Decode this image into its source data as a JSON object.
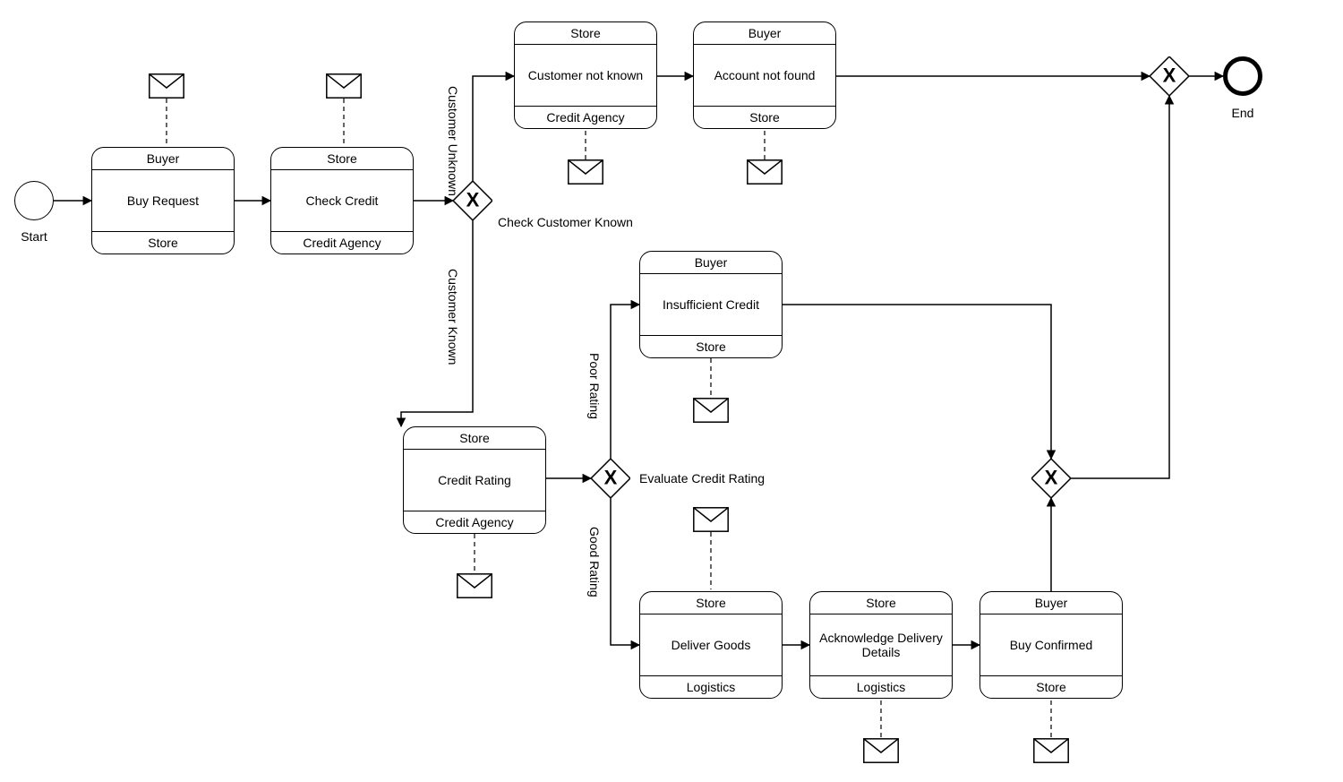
{
  "events": {
    "start": "Start",
    "end": "End"
  },
  "activities": {
    "buy_request": {
      "top": "Buyer",
      "body": "Buy Request",
      "bottom": "Store"
    },
    "check_credit": {
      "top": "Store",
      "body": "Check Credit",
      "bottom": "Credit Agency"
    },
    "customer_not_known": {
      "top": "Store",
      "body": "Customer not known",
      "bottom": "Credit Agency"
    },
    "account_not_found": {
      "top": "Buyer",
      "body": "Account not found",
      "bottom": "Store"
    },
    "credit_rating": {
      "top": "Store",
      "body": "Credit Rating",
      "bottom": "Credit Agency"
    },
    "insufficient_credit": {
      "top": "Buyer",
      "body": "Insufficient Credit",
      "bottom": "Store"
    },
    "deliver_goods": {
      "top": "Store",
      "body": "Deliver Goods",
      "bottom": "Logistics"
    },
    "ack_delivery": {
      "top": "Store",
      "body": "Acknowledge Delivery Details",
      "bottom": "Logistics"
    },
    "buy_confirmed": {
      "top": "Buyer",
      "body": "Buy Confirmed",
      "bottom": "Store"
    }
  },
  "gateways": {
    "g1_label": "Check Customer Known",
    "g2_label": "Evaluate Credit Rating"
  },
  "edge_labels": {
    "customer_unknown": "Customer Unknown",
    "customer_known": "Customer Known",
    "poor_rating": "Poor Rating",
    "good_rating": "Good Rating"
  }
}
